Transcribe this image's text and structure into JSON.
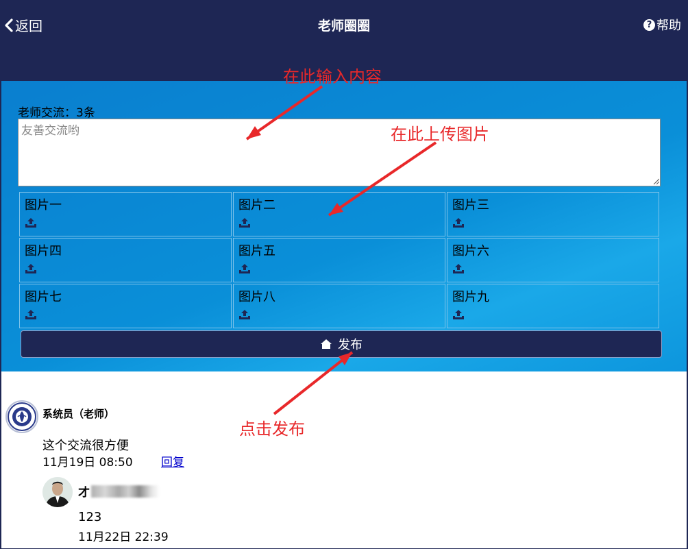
{
  "header": {
    "back_label": "返回",
    "title": "老师圈圈",
    "help_label": "帮助"
  },
  "compose": {
    "count_label": "老师交流：3条",
    "placeholder": "友善交流哟",
    "images": [
      {
        "label": "图片一"
      },
      {
        "label": "图片二"
      },
      {
        "label": "图片三"
      },
      {
        "label": "图片四"
      },
      {
        "label": "图片五"
      },
      {
        "label": "图片六"
      },
      {
        "label": "图片七"
      },
      {
        "label": "图片八"
      },
      {
        "label": "图片九"
      }
    ],
    "upload_icon": "upload-icon",
    "publish_label": "发布",
    "publish_icon": "home-icon"
  },
  "feed": {
    "post": {
      "author": "系统员（老师）",
      "content": "这个交流很方便",
      "time": "11月19日 08:50",
      "reply_label": "回复"
    },
    "reply": {
      "author_prefix": "才",
      "content": "123",
      "time": "11月22日 22:39"
    }
  },
  "annotations": {
    "input_hint": "在此输入内容",
    "upload_hint": "在此上传图片",
    "publish_hint": "点击发布"
  },
  "colors": {
    "header_bg": "#1e2654",
    "panel_blue": "#0a8fd8",
    "annotation_red": "#e8282a",
    "link_blue": "#0000cc"
  }
}
